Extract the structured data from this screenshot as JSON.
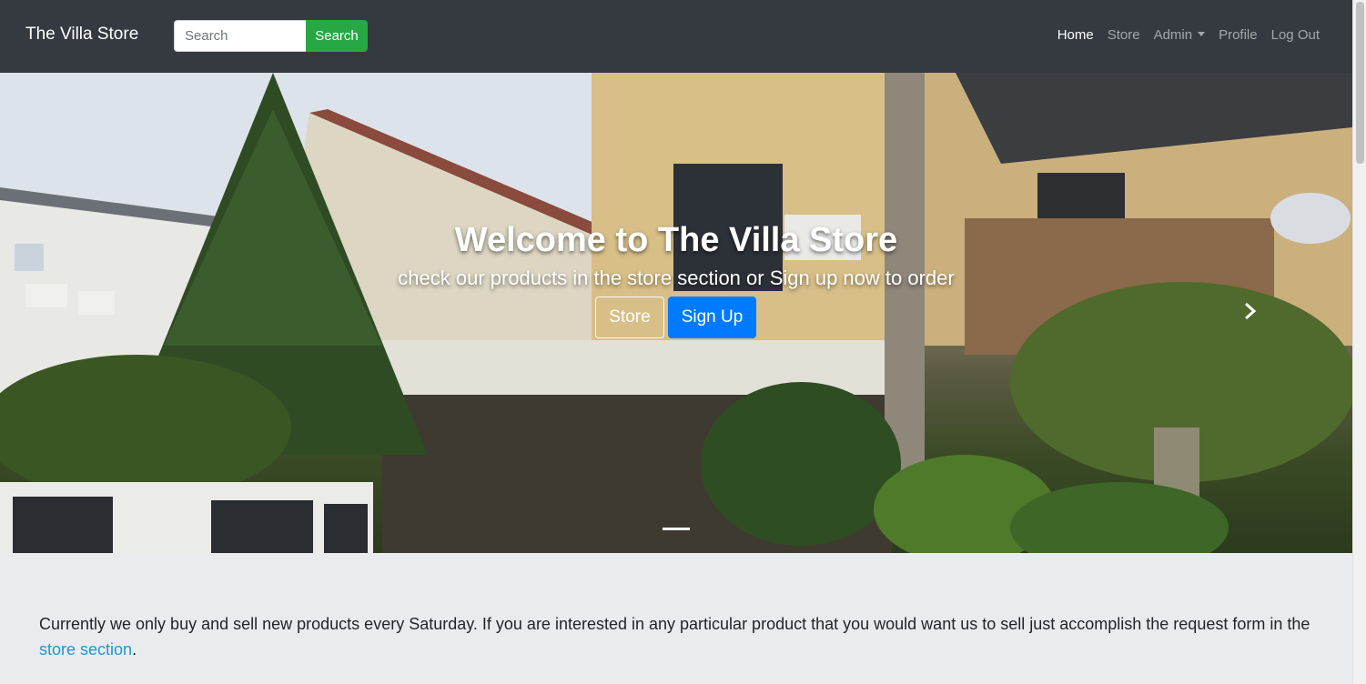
{
  "navbar": {
    "brand": "The Villa Store",
    "search": {
      "placeholder": "Search",
      "button_label": "Search"
    },
    "links": [
      {
        "label": "Home",
        "active": true
      },
      {
        "label": "Store"
      },
      {
        "label": "Admin"
      },
      {
        "label": "Profile"
      },
      {
        "label": "Log Out"
      }
    ]
  },
  "hero": {
    "title": "Welcome to The Villa Store",
    "subtitle": "check our products in the store section or Sign up now to order",
    "store_button": "Store",
    "signup_button": "Sign Up",
    "next_icon": "chevron-right-icon"
  },
  "content": {
    "text": "Currently we only buy and sell new products every Saturday. If you are interested in any particular product that you would want us to sell just accomplish the request form in the",
    "link": "store section",
    "suffix": "."
  },
  "colors": {
    "navbar_bg": "#343a40",
    "search_button": "#28a745",
    "primary_button": "#007bff",
    "link": "#2196d3",
    "page_bg": "#e9ecef"
  }
}
